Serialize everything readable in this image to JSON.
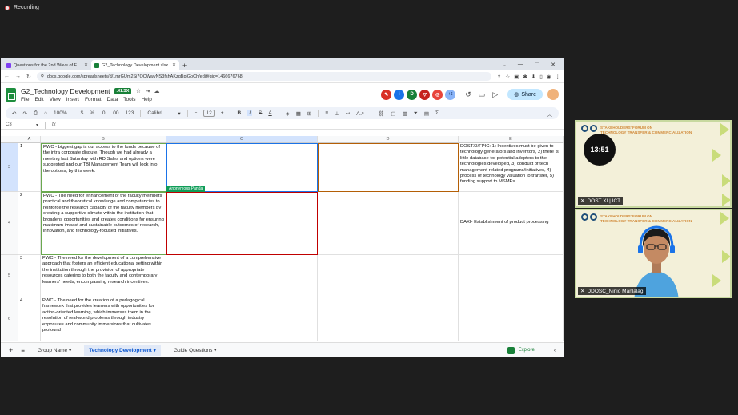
{
  "recording": {
    "label": "Recording"
  },
  "browser": {
    "tabs": [
      {
        "title": "Questions for the 2nd Wave of F",
        "fav_color": "#7e3ff2"
      },
      {
        "title": "G2_Technology Development.xlsx",
        "fav_color": "#188038"
      }
    ],
    "url": "docs.google.com/spreadsheets/d/1mrGUm2Sj7OCWwvNS3fshAKzgBpiGoCh/edit#gid=1466676768"
  },
  "doc": {
    "title": "G2_Technology Development",
    "badge": ".XLSX",
    "menus": [
      "File",
      "Edit",
      "View",
      "Insert",
      "Format",
      "Data",
      "Tools",
      "Help"
    ],
    "collaborators": [
      {
        "initial": "",
        "color": "#d93025"
      },
      {
        "initial": "i",
        "color": "#1a73e8"
      },
      {
        "initial": "D",
        "color": "#188038"
      },
      {
        "initial": "",
        "color": "#c5221f"
      },
      {
        "initial": "",
        "color": "#e8453c"
      },
      {
        "initial": "+5",
        "color": "#8ab4f8"
      }
    ],
    "share_label": "Share"
  },
  "toolbar": {
    "zoom": "100%",
    "currency": "$",
    "percent": "%",
    "dec_less": ".0",
    "dec_more": ".00",
    "num_format": "123",
    "font": "Calibri",
    "font_size": "12"
  },
  "formula_bar": {
    "cell_ref": "C3",
    "fx": "fx",
    "value": ""
  },
  "grid": {
    "columns": [
      "A",
      "B",
      "C",
      "D",
      "E"
    ],
    "rows": [
      {
        "num": "3",
        "a": "1",
        "b": " PWC -  biggest gap is our access to the funds because of the intra corporate dispute. Though we had already a meeting last Saturday with RD Sales and options were suggested and our TBI Management Team will look into the options, by this week.",
        "e": "DOSTXI/FPIC: 1) Incentives must be given to technology generators and inventors, 2) there is little database for potential adopters to the technologies developed, 3) conduct of tech management-related programs/initiatives, 4) process of technology valuation to transfer, 5) funding support to MSMEs"
      },
      {
        "num": "4",
        "a": "2",
        "b": "PWC - The need for enhancement of the faculty members' practical and theoretical knowledge and competencies to reinforce the research capacity of the faculty members by creating a supportive climate within the institution that broadens opportunities and creates conditions for ensuring maximum impact and sustainable outcomes of research, innovation, and technology-focused initiatives.",
        "e": "DAXI- Establishment of product processing"
      },
      {
        "num": "5",
        "a": "3",
        "b": "PWC - The need for the development of a comprehensive approach that fosters an efficient educational setting within the institution through the provision of appropriate resources catering to both the faculty and contemporary learners' needs, encompassing research incentives.",
        "e": ""
      },
      {
        "num": "6",
        "a": "4",
        "b": "PWC - The need for the creation of a pedagogical framework that provides learners with opportunities for action-oriented learning, which immerses them in the resolution of real-world problems through industry exposures and community immersions that cultivates profound",
        "e": ""
      }
    ],
    "cursor_label": "Anonymous Panda"
  },
  "sheets": {
    "tabs": [
      "Group Name",
      "Technology Development",
      "Guide Questions"
    ],
    "active": "Technology Development",
    "explore_label": "Explore"
  },
  "video": [
    {
      "name": "DOST XI | ICT",
      "timer": "13:51",
      "banner_line1": "STAKEHOLDERS' FORUM ON",
      "banner_line2": "TECHNOLOGY TRANSFER & COMMERCIALIZATION"
    },
    {
      "name": "DDOSC_Ninio Manlalag",
      "banner_line1": "STAKEHOLDERS' FORUM ON",
      "banner_line2": "TECHNOLOGY TRANSFER & COMMERCIALIZATION"
    }
  ]
}
